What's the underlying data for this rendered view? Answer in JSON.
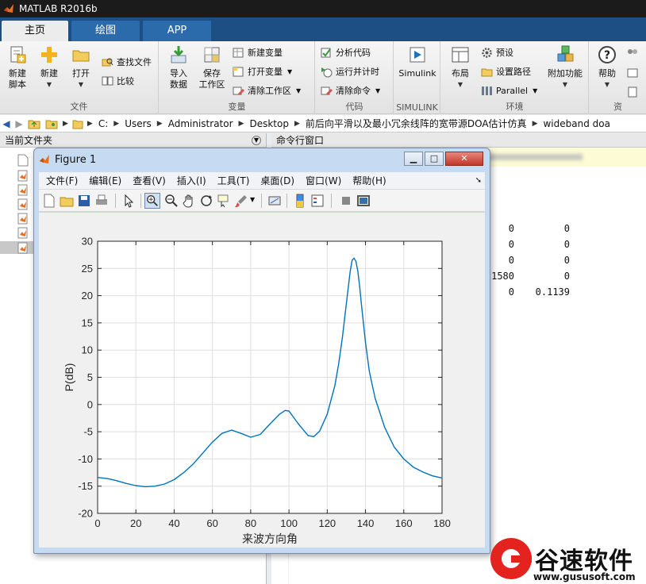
{
  "app": {
    "title": "MATLAB R2016b"
  },
  "tabs": [
    {
      "label": "主页",
      "active": true
    },
    {
      "label": "绘图",
      "active": false
    },
    {
      "label": "APP",
      "active": false
    }
  ],
  "ribbon": {
    "file": {
      "group_label": "文件",
      "new_script": [
        "新建",
        "脚本"
      ],
      "new": "新建",
      "open": "打开",
      "find_files": "查找文件",
      "compare": "比较"
    },
    "variable": {
      "group_label": "变量",
      "import": [
        "导入",
        "数据"
      ],
      "save_ws": [
        "保存",
        "工作区"
      ],
      "new_var": "新建变量",
      "open_var": "打开变量",
      "clear_ws": "清除工作区"
    },
    "code": {
      "group_label": "代码",
      "analyze": "分析代码",
      "run_time": "运行并计时",
      "clear_cmds": "清除命令"
    },
    "simulink": {
      "group_label": "SIMULINK",
      "simulink": "Simulink"
    },
    "env": {
      "group_label": "环境",
      "layout": "布局",
      "prefs": "预设",
      "set_path": "设置路径",
      "parallel": "Parallel",
      "addons": "附加功能"
    },
    "resources": {
      "group_label": "资",
      "help": "帮助"
    }
  },
  "address": {
    "crumbs": [
      "C:",
      "Users",
      "Administrator",
      "Desktop",
      "前后向平滑以及最小冗余线阵的宽带源DOA估计仿真",
      "wideband doa"
    ]
  },
  "left_panel": {
    "title": "当前文件夹"
  },
  "right_panel": {
    "title": "命令行窗口",
    "rows": [
      [
        "0",
        "0"
      ],
      [
        "0",
        "0"
      ],
      [
        "0",
        "0"
      ],
      [
        "1580",
        "0"
      ],
      [
        "0",
        "0.1139"
      ]
    ]
  },
  "figure": {
    "title": "Figure 1",
    "menu": [
      "文件(F)",
      "编辑(E)",
      "查看(V)",
      "插入(I)",
      "工具(T)",
      "桌面(D)",
      "窗口(W)",
      "帮助(H)"
    ]
  },
  "chart_data": {
    "type": "line",
    "title": "",
    "xlabel": "来波方向角",
    "ylabel": "P(dB)",
    "xlim": [
      0,
      180
    ],
    "ylim": [
      -20,
      30
    ],
    "xticks": [
      0,
      20,
      40,
      60,
      80,
      100,
      120,
      140,
      160,
      180
    ],
    "yticks": [
      -20,
      -15,
      -10,
      -5,
      0,
      5,
      10,
      15,
      20,
      25,
      30
    ],
    "grid": true,
    "color": "#0072bd",
    "series": [
      {
        "x": [
          0,
          5,
          10,
          15,
          20,
          25,
          30,
          35,
          40,
          45,
          50,
          55,
          60,
          65,
          70,
          75,
          80,
          85,
          90,
          95,
          98,
          100,
          105,
          110,
          113,
          116,
          120,
          124,
          126,
          128,
          130,
          132,
          133,
          134,
          135,
          136,
          137,
          138,
          140,
          142,
          145,
          150,
          155,
          160,
          165,
          170,
          175,
          180
        ],
        "y": [
          -13.4,
          -13.6,
          -14.0,
          -14.5,
          -14.9,
          -15.1,
          -15.0,
          -14.6,
          -13.8,
          -12.5,
          -10.9,
          -8.9,
          -6.9,
          -5.3,
          -4.7,
          -5.3,
          -6.0,
          -5.5,
          -3.6,
          -1.8,
          -1.1,
          -1.2,
          -3.6,
          -5.7,
          -5.9,
          -4.9,
          -1.8,
          3.5,
          7.5,
          12.5,
          18.5,
          24.5,
          26.5,
          26.9,
          26.3,
          24.5,
          21.5,
          18.0,
          11.3,
          6.1,
          1.2,
          -4.2,
          -7.8,
          -10.0,
          -11.5,
          -12.4,
          -13.1,
          -13.5
        ]
      }
    ]
  },
  "watermark": {
    "brand_cn": "谷速软件",
    "url": "www.gususoft.com"
  }
}
